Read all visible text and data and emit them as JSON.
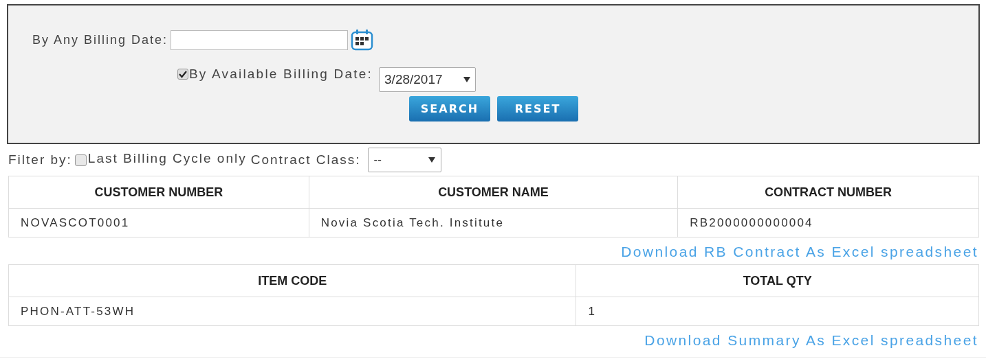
{
  "search_panel": {
    "any_date_label": "By Any Billing Date:",
    "available_date_checked": true,
    "available_date_label": "By Available Billing Date:",
    "available_date_value": "3/28/2017",
    "buttons": [
      "SEARCH",
      "RESET"
    ]
  },
  "filter": {
    "label": "Filter by:",
    "last_cycle_checked": false,
    "last_cycle_label": "Last Billing Cycle only",
    "contract_class_label": "Contract Class:",
    "contract_class_value": "--"
  },
  "contract_table": {
    "columns": [
      "CUSTOMER NUMBER",
      "CUSTOMER NAME",
      "CONTRACT NUMBER"
    ],
    "rows": [
      [
        "NOVASCOT0001",
        "Novia Scotia Tech. Institute",
        "RB2000000000004"
      ]
    ]
  },
  "contract_download_link": "Download RB Contract As Excel spreadsheet",
  "summary_table": {
    "columns": [
      "ITEM CODE",
      "TOTAL QTY"
    ],
    "rows": [
      [
        "PHON-ATT-53WH",
        "1"
      ]
    ]
  },
  "summary_download_link": "Download Summary As Excel spreadsheet"
}
